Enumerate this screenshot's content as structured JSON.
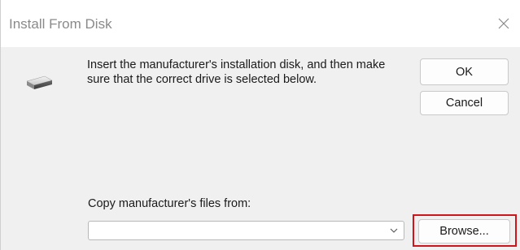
{
  "window": {
    "title": "Install From Disk"
  },
  "icons": {
    "close": "close-icon",
    "disk": "disk-drive-icon",
    "dropdown": "chevron-down-icon"
  },
  "message": "Insert the manufacturer's installation disk, and then make sure that the correct drive is selected below.",
  "buttons": {
    "ok": "OK",
    "cancel": "Cancel",
    "browse": "Browse..."
  },
  "copy_from": {
    "label": "Copy manufacturer's files from:",
    "value": ""
  },
  "colors": {
    "highlight": "#d0141c"
  }
}
